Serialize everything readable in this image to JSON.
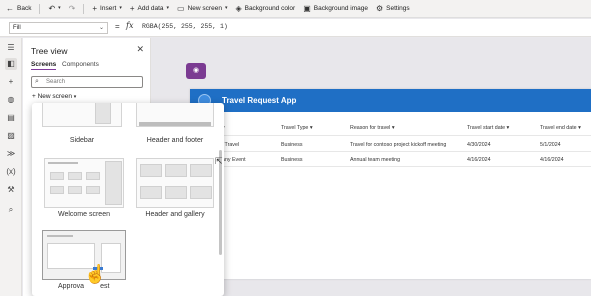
{
  "toolbar": {
    "back_label": "Back",
    "insert_label": "Insert",
    "add_data_label": "Add data",
    "new_screen_label": "New screen",
    "background_color_label": "Background color",
    "background_image_label": "Background image",
    "settings_label": "Settings"
  },
  "formula_bar": {
    "property": "Fill",
    "fx_label": "fx",
    "formula": "RGBA(255, 255, 255, 1)"
  },
  "tree_view": {
    "title": "Tree view",
    "tabs": [
      "Screens",
      "Components"
    ],
    "active_tab": "Screens",
    "search_placeholder": "Search",
    "new_screen_label": "New screen"
  },
  "layout_picker": {
    "items": [
      {
        "label": "Sidebar"
      },
      {
        "label": "Header and footer"
      },
      {
        "label": "Welcome screen"
      },
      {
        "label": "Header and gallery"
      },
      {
        "label": "Approva"
      },
      {
        "label": "est"
      }
    ]
  },
  "app": {
    "title": "Travel Request App",
    "columns": [
      "Travel Type",
      "Reason for travel",
      "Travel start date",
      "Travel end date"
    ],
    "rows": [
      {
        "name": "l Travel",
        "type": "Business",
        "reason": "Travel for contoso project kickoff meeting",
        "start": "4/30/2024",
        "end": "5/1/2024"
      },
      {
        "name": "any Event",
        "type": "Business",
        "reason": "Annual team meeting",
        "start": "4/16/2024",
        "end": "4/16/2024"
      }
    ]
  },
  "colors": {
    "accent_purple": "#7b3b92",
    "app_header_blue": "#1f6fc5"
  },
  "icons": [
    "back-arrow-icon",
    "undo-icon",
    "redo-icon",
    "insert-plus-icon",
    "add-data-plus-icon",
    "new-screen-icon",
    "paint-bucket-icon",
    "image-icon",
    "gear-icon",
    "close-icon",
    "search-icon",
    "hand-pointer-icon"
  ]
}
